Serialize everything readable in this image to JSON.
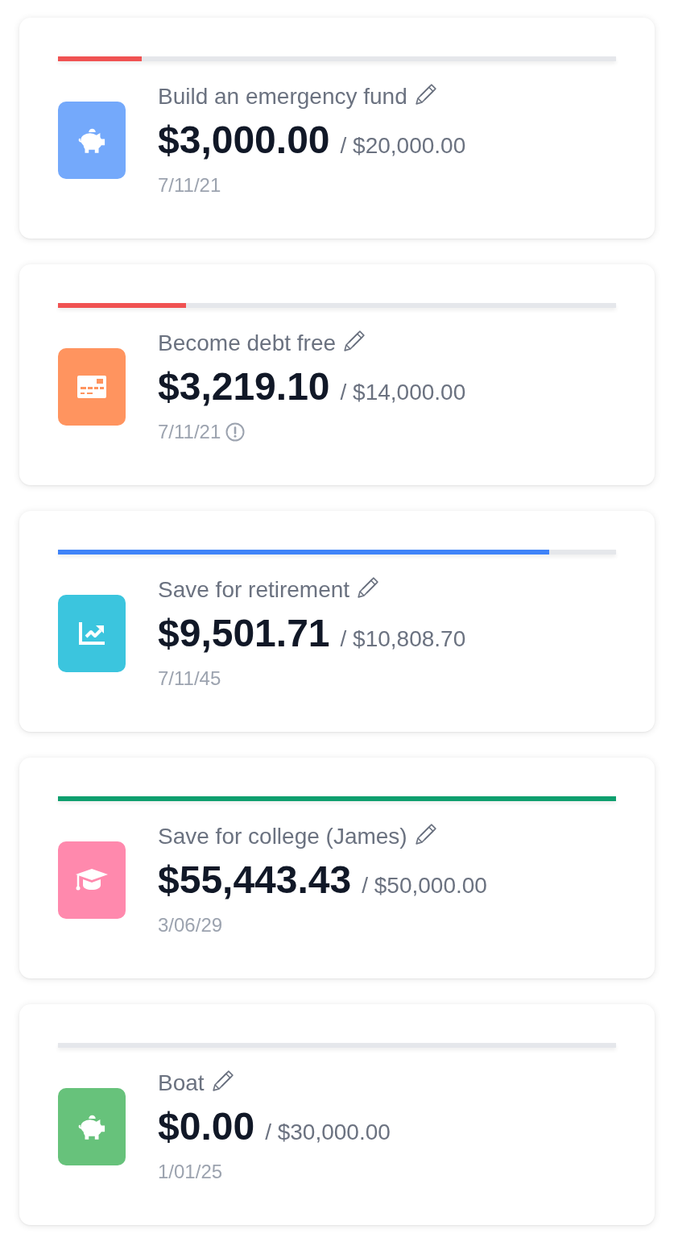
{
  "goals": [
    {
      "icon": {
        "kind": "piggy-bank",
        "color": "#74a9fb"
      },
      "progress": {
        "level": 0.15,
        "color": "#f05252"
      },
      "title": "Build an emergency fund",
      "amount": "$3,000.00",
      "target": "/ $20,000.00",
      "date": "7/11/21",
      "alert": false
    },
    {
      "icon": {
        "kind": "credit-card",
        "color": "#ff945f"
      },
      "progress": {
        "level": 0.23,
        "color": "#f05252"
      },
      "title": "Become debt free",
      "amount": "$3,219.10",
      "target": "/ $14,000.00",
      "date": "7/11/21",
      "alert": true
    },
    {
      "icon": {
        "kind": "chart",
        "color": "#3bc5de"
      },
      "progress": {
        "level": 0.88,
        "color": "#3f83f8"
      },
      "title": "Save for retirement",
      "amount": "$9,501.71",
      "target": "/ $10,808.70",
      "date": "7/11/45",
      "alert": false
    },
    {
      "icon": {
        "kind": "graduation-cap",
        "color": "#ff89ad"
      },
      "progress": {
        "level": 1,
        "color": "#0e9f6e"
      },
      "title": "Save for college (James)",
      "amount": "$55,443.43",
      "target": "/ $50,000.00",
      "date": "3/06/29",
      "alert": false
    },
    {
      "icon": {
        "kind": "piggy-bank",
        "color": "#67c27b"
      },
      "title": "Boat",
      "amount": "$0.00",
      "target": "/ $30,000.00",
      "date": "1/01/25",
      "alert": false
    }
  ]
}
